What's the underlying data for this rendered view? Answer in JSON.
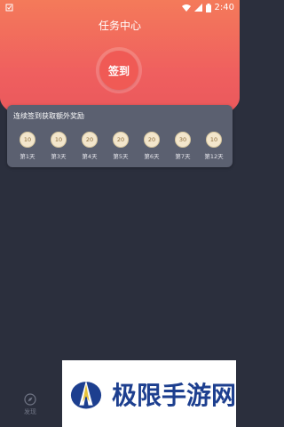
{
  "status_bar": {
    "time": "2:40"
  },
  "header": {
    "title": "任务中心",
    "sign_button": "签到"
  },
  "streak_card": {
    "title": "连续签到获取额外奖励",
    "days": [
      {
        "coins": "10",
        "label": "第1天"
      },
      {
        "coins": "10",
        "label": "第3天"
      },
      {
        "coins": "20",
        "label": "第4天"
      },
      {
        "coins": "20",
        "label": "第5天"
      },
      {
        "coins": "20",
        "label": "第6天"
      },
      {
        "coins": "30",
        "label": "第7天"
      },
      {
        "coins": "10",
        "label": "第12天"
      }
    ]
  },
  "bottom_nav": {
    "items": [
      {
        "label": "发现",
        "icon": "compass-icon"
      }
    ]
  },
  "watermark": {
    "text": "极限手游网"
  }
}
